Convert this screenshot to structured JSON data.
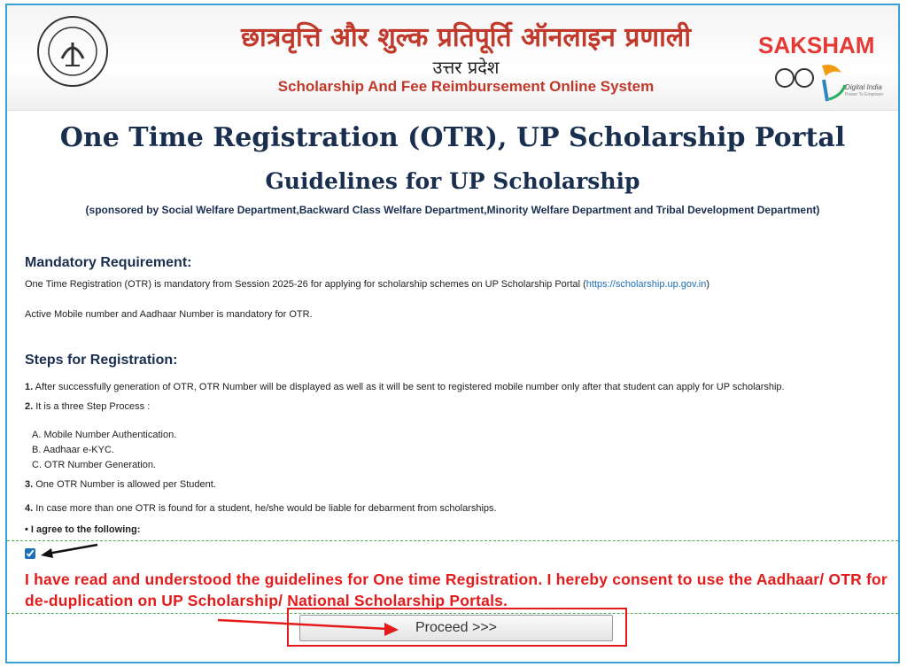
{
  "header": {
    "hindi_title": "छात्रवृत्ति और शुल्क प्रतिपूर्ति ऑनलाइन प्रणाली",
    "hindi_state": "उत्तर प्रदेश",
    "english_title": "Scholarship And Fee Reimbursement Online System",
    "saksham": "SAKSHAM",
    "digital_india": "Digital India",
    "digital_india_tag": "Power To Empower"
  },
  "page": {
    "title": "One Time Registration (OTR), UP Scholarship Portal",
    "subtitle": "Guidelines for UP Scholarship",
    "sponsor": "(sponsored by Social Welfare Department,Backward Class Welfare Department,Minority Welfare Department and Tribal Development Department)"
  },
  "mandatory": {
    "heading": "Mandatory Requirement:",
    "line1_prefix": "One Time Registration (OTR) is mandatory from Session 2025-26 for applying for scholarship schemes on UP Scholarship Portal (",
    "line1_link": "https://scholarship.up.gov.in",
    "line1_suffix": ")",
    "line2": "Active Mobile number and Aadhaar Number is mandatory for OTR."
  },
  "steps": {
    "heading": "Steps for Registration:",
    "item1_num": "1.",
    "item1": "After successfully generation of OTR, OTR Number will be displayed as well as it will be sent to registered mobile number only after that student can apply for UP scholarship.",
    "item2_num": "2.",
    "item2": "It is a three Step Process :",
    "sub_a": "A.  Mobile Number Authentication.",
    "sub_b": "B.  Aadhaar e-KYC.",
    "sub_c": "C.  OTR Number Generation.",
    "item3_num": "3.",
    "item3": "One OTR Number is allowed per Student.",
    "item4_num": "4.",
    "item4": "In case more than one OTR is found for a student, he/she would be liable for debarment from scholarships."
  },
  "agree": {
    "bullet": "• I agree to the following:",
    "consent": "I have read and understood the guidelines for One time Registration. I hereby consent to use the Aadhaar/ OTR for de-duplication on UP Scholarship/ National Scholarship Portals.",
    "checked": true
  },
  "proceed_label": "Proceed >>>",
  "colors": {
    "heading": "#1a2f4f",
    "consent_red": "#e31b1b",
    "link": "#1e6fb8",
    "frame": "#3aa0d8"
  }
}
